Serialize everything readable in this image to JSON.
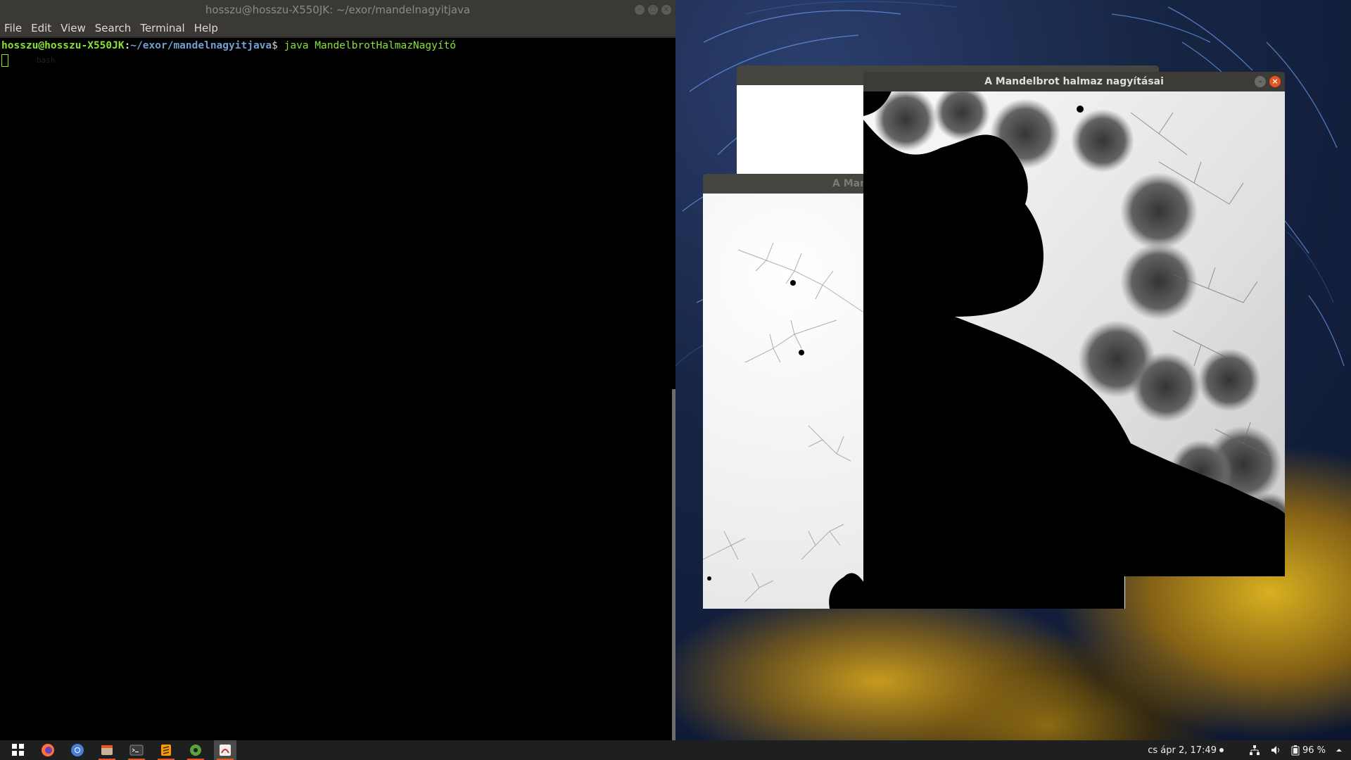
{
  "terminal": {
    "title": "hosszu@hosszu-X550JK: ~/exor/mandelnagyitjava",
    "menu": [
      "File",
      "Edit",
      "View",
      "Search",
      "Terminal",
      "Help"
    ],
    "prompt_user": "hosszu@hosszu-X550JK",
    "prompt_path": "~/exor/mandelnagyitjava",
    "prompt_symbol": "$",
    "command": "java MandelbrotHalmazNagyító",
    "ghost_text": "bash"
  },
  "windows": {
    "back_title": "",
    "middle_title": "A Man",
    "front_title": "A Mandelbrot halmaz nagyításai",
    "minimize_glyph": "–",
    "maximize_glyph": "□",
    "close_glyph": "×"
  },
  "panel": {
    "launchers": [
      {
        "icon": "app-grid-icon",
        "label": "",
        "active": false
      },
      {
        "icon": "firefox-icon",
        "label": "",
        "active": false
      },
      {
        "icon": "chromium-icon",
        "label": "",
        "active": false
      },
      {
        "icon": "files-icon",
        "label": "",
        "active": true
      },
      {
        "icon": "terminal-icon",
        "label": "",
        "active": true
      },
      {
        "icon": "sublime-icon",
        "label": "",
        "active": true
      },
      {
        "icon": "settings-gear-icon",
        "label": "",
        "active": true
      },
      {
        "icon": "java-app-icon",
        "label": "",
        "active": true
      }
    ],
    "clock": "cs ápr  2, 17:49",
    "battery": "96 %",
    "tray_icons": [
      "network-icon",
      "volume-icon",
      "battery-icon",
      "arrow-up-icon"
    ]
  },
  "colors": {
    "terminal_bg": "#000000",
    "prompt_green": "#8ae234",
    "prompt_blue": "#729fcf",
    "titlebar": "#3c3b37",
    "close_orange": "#e9541f",
    "panel_bg": "#1e1f21"
  }
}
